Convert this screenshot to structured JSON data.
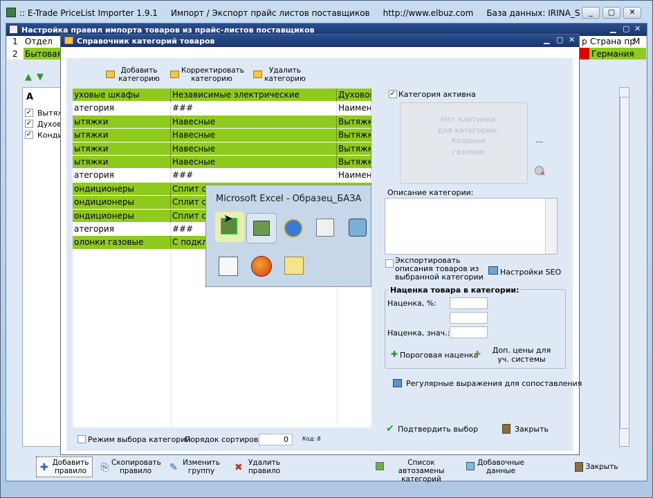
{
  "app_window": {
    "title": ":: E-Trade PriceList Importer 1.9.1     Импорт / Экспорт прайс листов поставщиков     http://www.elbuz.com     База данных: IRINA_S"
  },
  "rules_window": {
    "title": "Настройка правил импорта товаров из прайс-листов поставщиков",
    "grid_header": {
      "row1_num": "1",
      "row1_col1": "Отдел",
      "row1_right1": "Страна пр",
      "row1_right0": "р",
      "row1_right2": "М",
      "row2_num": "2",
      "row2_col1": "Бытовая",
      "row2_right1": "Германия"
    },
    "left_col_header": "A",
    "left_list": [
      {
        "label": "Вытяж",
        "checked": true
      },
      {
        "label": "Духов",
        "checked": true
      },
      {
        "label": "Конди",
        "checked": true
      }
    ],
    "bottom_toolbar": [
      {
        "label": "Добавить правило"
      },
      {
        "label": "Скопировать правило"
      },
      {
        "label": "Изменить группу"
      },
      {
        "label": "Удалить правило"
      },
      {
        "label": "Список автозамены категорий"
      },
      {
        "label": "Добавочные данные"
      },
      {
        "label": "Закрыть"
      }
    ]
  },
  "category_dialog": {
    "title": "Справочник категорий товаров",
    "toolbar": [
      {
        "label": "Добавить категорию",
        "icon": "folder-add-icon"
      },
      {
        "label": "Корректировать категорию",
        "icon": "folder-edit-icon"
      },
      {
        "label": "Удалить категорию",
        "icon": "folder-delete-icon"
      }
    ],
    "rows": [
      {
        "c1": "уховые шкафы",
        "c2": "Независимые электрические",
        "c3": "Духовой",
        "green": true
      },
      {
        "c1": "атегория",
        "c2": "###",
        "c3": "Наимено",
        "green": false
      },
      {
        "c1": "ытяжки",
        "c2": "Навесные",
        "c3": "Вытяжка",
        "green": true
      },
      {
        "c1": "ытяжки",
        "c2": "Навесные",
        "c3": "Вытяжка",
        "green": true
      },
      {
        "c1": "ытяжки",
        "c2": "Навесные",
        "c3": "Вытяжка",
        "green": true
      },
      {
        "c1": "ытяжки",
        "c2": "Навесные",
        "c3": "Вытяжка",
        "green": true
      },
      {
        "c1": "атегория",
        "c2": "###",
        "c3": "Наимено",
        "green": false
      },
      {
        "c1": "ондиционеры",
        "c2": "Сплит си",
        "c3": "",
        "green": true
      },
      {
        "c1": "ондиционеры",
        "c2": "Сплит си",
        "c3": "",
        "green": true
      },
      {
        "c1": "ондиционеры",
        "c2": "Сплит си",
        "c3": "",
        "green": true
      },
      {
        "c1": "атегория",
        "c2": "###",
        "c3": "",
        "green": false
      },
      {
        "c1": "олонки газовые",
        "c2": "С подкл",
        "c3": "",
        "green": true
      }
    ],
    "category_active_label": "Категория активна",
    "category_active_checked": true,
    "image_placeholder": "Нет картинки для категории: Колонки газовые",
    "browse_button": "...",
    "description_label": "Описание категории:",
    "description_value": "",
    "export_desc_label": "Экспортировать описания товаров из выбранной категории",
    "seo_button": "Настройки SEO",
    "markup_group_title": "Наценка товара в категории:",
    "markup_percent_label": "Наценка, %:",
    "markup_value_label": "Наценка, знач.:",
    "markup_percent_value": "",
    "markup_extra_value": "",
    "markup_value_value": "",
    "threshold_button": "Пороговая наценка",
    "extra_prices_button": "Доп. цены для уч. системы",
    "regex_button": "Регулярные выражения для сопоставления",
    "mode_label": "Режим выбора категорий",
    "sort_label": "Порядок сортировки:",
    "sort_value": "0",
    "code_label": "Код: 8",
    "confirm_button": "Подтвердить выбор",
    "close_button": "Закрыть"
  },
  "taskbar_popup": {
    "title": "Microsoft Excel - Образец_БАЗА",
    "apps": [
      "excel-icon",
      "excel-chart-icon",
      "ie-icon",
      "notepad-icon",
      "network-icon",
      "word-icon",
      "firefox-icon",
      "sticky-note-icon"
    ]
  }
}
